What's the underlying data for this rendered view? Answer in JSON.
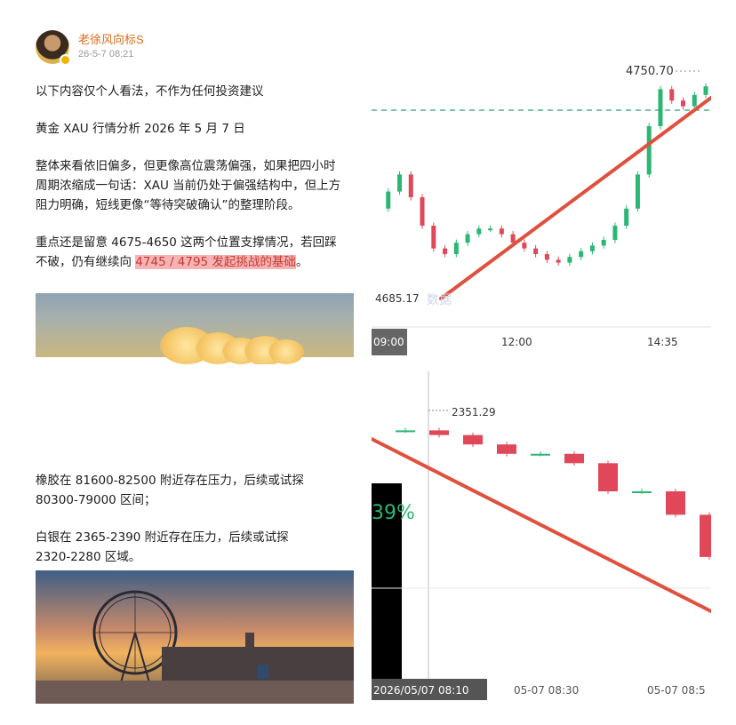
{
  "post": {
    "author": "老徐风向标S",
    "time": "26-5-7 08:21",
    "lines": [
      "以下内容仅个人看法，不作为任何投资建议",
      "黄金 XAU 行情分析  2026 年 5 月 7 日",
      "整体来看依旧偏多，但更像高位震荡偏强，如果把四小时",
      "周期浓缩成一句话：XAU 当前仍处于偏强结构中，但上方",
      "阻力明确，短线更像“等待突破确认”的整理阶段。",
      "重点还是留意 4675-4650 这两个位置支撑情况，若回踩",
      "不破，仍有继续向 ",
      "4745 / 4795 发起挑战的基础",
      "。"
    ],
    "lower_lines": [
      "橡胶在 81600-82500 附近存在压力，后续或试探",
      "80300-79000 区间；",
      "白银在 2365-2390 附近存在压力，后续或试探",
      "2320-2280 区域。"
    ]
  },
  "chart_top": {
    "high_label": "4750.70",
    "low_label": "4685.17",
    "x_ticks": [
      "09:00",
      "12:00",
      "14:35"
    ],
    "watermark": "数据",
    "colors": {
      "up": "#2bb673",
      "down": "#e0485a",
      "trend": "#e0503e",
      "dash": "#2aa06f"
    }
  },
  "chart_bottom": {
    "price_label": "2351.29",
    "x_ticks": [
      "2026/05/07 08:10",
      "05-07 08:30",
      "05-07 08:5"
    ],
    "side_badge": "39%",
    "colors": {
      "up": "#2bb673",
      "down": "#e0485a",
      "trend": "#e0503e"
    }
  },
  "chart_data": [
    {
      "type": "candlestick",
      "title": "",
      "x_ticks": [
        "09:00",
        "12:00",
        "14:35"
      ],
      "y_annotations": [
        4750.7,
        4685.17
      ],
      "candles_close_trend": "up",
      "series": [
        {
          "values": [
            4706,
            4712,
            4718,
            4710,
            4700,
            4692,
            4690,
            4694,
            4697,
            4699,
            4699,
            4697,
            4694,
            4692,
            4690,
            4688,
            4687,
            4689,
            4691,
            4693,
            4695,
            4700,
            4706,
            4718,
            4735,
            4748,
            4744,
            4742,
            4746,
            4749
          ]
        }
      ]
    },
    {
      "type": "candlestick",
      "title": "",
      "x_ticks": [
        "2026/05/07 08:10",
        "05-07 08:30",
        "05-07 08:5"
      ],
      "y_annotations": [
        2351.29
      ],
      "series": [
        {
          "values": [
            2351,
            2351,
            2350,
            2348,
            2346,
            2346,
            2344,
            2338,
            2338,
            2333,
            2324
          ]
        }
      ]
    }
  ]
}
